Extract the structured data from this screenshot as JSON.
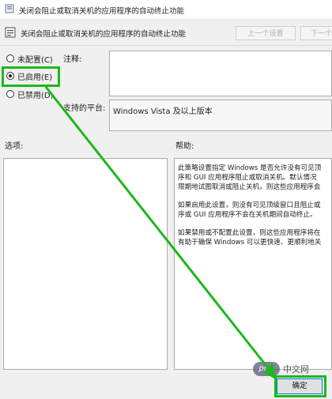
{
  "window": {
    "title": "关闭会阻止或取消关机的应用程序的自动终止功能"
  },
  "header": {
    "policy_title": "关闭会阻止或取消关机的应用程序的自动终止功能",
    "prev_label": "上一个设置",
    "next_label": "下一个"
  },
  "radios": [
    {
      "label": "未配置(C)",
      "selected": false
    },
    {
      "label": "已启用(E)",
      "selected": true
    },
    {
      "label": "已禁用(D)",
      "selected": false
    }
  ],
  "labels": {
    "comment": "注释:",
    "platform": "支持的平台:",
    "options": "选项:",
    "help": "帮助:"
  },
  "platform_value": "Windows Vista 及以上版本",
  "help": {
    "para1": [
      "此策略设置指定 Windows 是否允许没有可见顶",
      "序和 GUI 应用程序阻止或取消关机。默认情况",
      "限期地试图取消或阻止关机，则这些应用程序会"
    ],
    "para2": [
      "如果启用此设置，则没有可见顶级窗口且阻止或",
      "序或 GUI 应用程序不会在关机期间自动终止。"
    ],
    "para3": [
      "如果禁用或不配置此设置，则这些应用程序将在",
      "有助于确保 Windows 可以更快速、更顺利地关"
    ]
  },
  "ok_label": "确定",
  "watermark": {
    "logo": "php",
    "text": "中文网"
  },
  "colors": {
    "annotation": "#1db81d",
    "focus_border": "#0078d7"
  }
}
